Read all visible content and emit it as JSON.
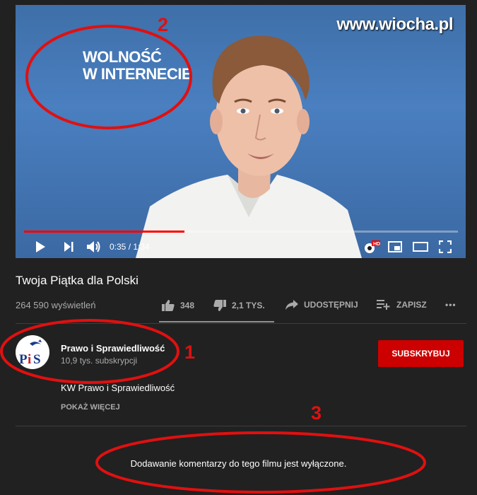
{
  "watermark": "www.wiocha.pl",
  "video": {
    "slogan_line1": "WOLNOŚĆ",
    "slogan_line2": "W INTERNECIE",
    "time": "0:35 / 1:34",
    "progress": 0.37,
    "hd_badge": "HD"
  },
  "title": "Twoja Piątka dla Polski",
  "views": "264 590 wyświetleń",
  "actions": {
    "likes": "348",
    "dislikes": "2,1 TYS.",
    "share": "UDOSTĘPNIJ",
    "save": "ZAPISZ",
    "more": "•••"
  },
  "channel": {
    "name": "Prawo i Sprawiedliwość",
    "subscribers": "10,9 tys. subskrypcji",
    "avatar_text": "PiS",
    "subscribe_label": "SUBSKRYBUJ"
  },
  "description": "KW Prawo i Sprawiedliwość",
  "show_more": "POKAŻ WIĘCEJ",
  "comments_disabled": "Dodawanie komentarzy do tego filmu jest wyłączone.",
  "annotations": {
    "n1": "1",
    "n2": "2",
    "n3": "3"
  },
  "colors": {
    "accent_red": "#cc0000",
    "annotation_red": "#e01010",
    "background": "#212121"
  }
}
